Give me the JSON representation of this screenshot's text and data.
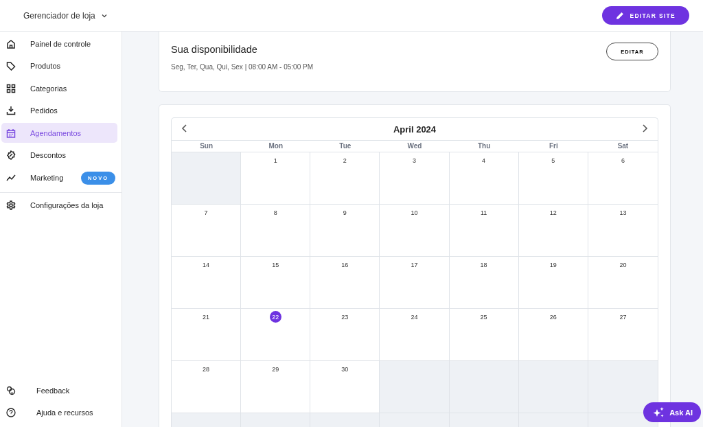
{
  "header": {
    "store_menu": "Gerenciador de loja",
    "edit_site_button": "EDITAR SITE"
  },
  "sidebar": {
    "items": [
      {
        "label": "Painel de controle",
        "selected": false
      },
      {
        "label": "Produtos",
        "selected": false
      },
      {
        "label": "Categorias",
        "selected": false
      },
      {
        "label": "Pedidos",
        "selected": false
      },
      {
        "label": "Agendamentos",
        "selected": true
      },
      {
        "label": "Descontos",
        "selected": false
      },
      {
        "label": "Marketing",
        "selected": false,
        "badge": "NOVO"
      }
    ],
    "settings_item": {
      "label": "Configurações da loja",
      "selected": false
    },
    "footer_items": [
      {
        "label": "Feedback"
      },
      {
        "label": "Ajuda e recursos"
      }
    ]
  },
  "availability": {
    "title": "Sua disponibilidade",
    "schedule": "Seg, Ter, Qua, Qui, Sex | 08:00 AM - 05:00 PM",
    "edit_button": "EDITAR"
  },
  "calendar": {
    "month": "April 2024",
    "weekdays": [
      "Sun",
      "Mon",
      "Tue",
      "Wed",
      "Thu",
      "Fri",
      "Sat"
    ],
    "weeks": [
      [
        {
          "in_month": false
        },
        {
          "day": "1",
          "in_month": true,
          "selected": false
        },
        {
          "day": "2",
          "in_month": true,
          "selected": false
        },
        {
          "day": "3",
          "in_month": true,
          "selected": false
        },
        {
          "day": "4",
          "in_month": true,
          "selected": false
        },
        {
          "day": "5",
          "in_month": true,
          "selected": false
        },
        {
          "day": "6",
          "in_month": true,
          "selected": false
        }
      ],
      [
        {
          "day": "7",
          "in_month": true,
          "selected": false
        },
        {
          "day": "8",
          "in_month": true,
          "selected": false
        },
        {
          "day": "9",
          "in_month": true,
          "selected": false
        },
        {
          "day": "10",
          "in_month": true,
          "selected": false
        },
        {
          "day": "11",
          "in_month": true,
          "selected": false
        },
        {
          "day": "12",
          "in_month": true,
          "selected": false
        },
        {
          "day": "13",
          "in_month": true,
          "selected": false
        }
      ],
      [
        {
          "day": "14",
          "in_month": true,
          "selected": false
        },
        {
          "day": "15",
          "in_month": true,
          "selected": false
        },
        {
          "day": "16",
          "in_month": true,
          "selected": false
        },
        {
          "day": "17",
          "in_month": true,
          "selected": false
        },
        {
          "day": "18",
          "in_month": true,
          "selected": false
        },
        {
          "day": "19",
          "in_month": true,
          "selected": false
        },
        {
          "day": "20",
          "in_month": true,
          "selected": false
        }
      ],
      [
        {
          "day": "21",
          "in_month": true,
          "selected": false
        },
        {
          "day": "22",
          "in_month": true,
          "selected": true
        },
        {
          "day": "23",
          "in_month": true,
          "selected": false
        },
        {
          "day": "24",
          "in_month": true,
          "selected": false
        },
        {
          "day": "25",
          "in_month": true,
          "selected": false
        },
        {
          "day": "26",
          "in_month": true,
          "selected": false
        },
        {
          "day": "27",
          "in_month": true,
          "selected": false
        }
      ],
      [
        {
          "day": "28",
          "in_month": true,
          "selected": false
        },
        {
          "day": "29",
          "in_month": true,
          "selected": false
        },
        {
          "day": "30",
          "in_month": true,
          "selected": false
        },
        {
          "in_month": false
        },
        {
          "in_month": false
        },
        {
          "in_month": false
        },
        {
          "in_month": false
        }
      ],
      [
        {
          "in_month": false
        },
        {
          "in_month": false
        },
        {
          "in_month": false
        },
        {
          "in_month": false
        },
        {
          "in_month": false
        },
        {
          "in_month": false
        },
        {
          "in_month": false
        }
      ]
    ]
  },
  "ask_ai_button": "Ask AI"
}
